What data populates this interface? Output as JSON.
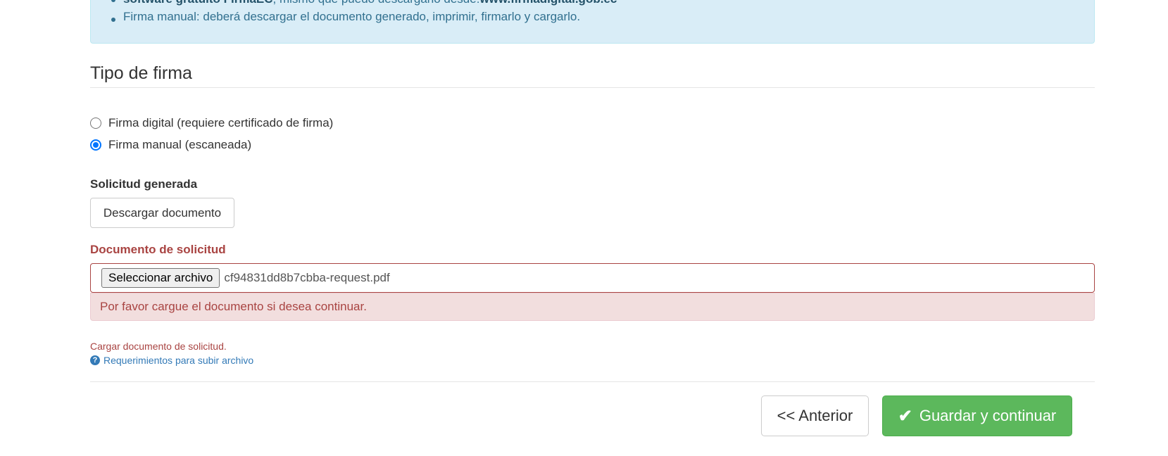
{
  "info": {
    "line1_prefix": "software gratuito ",
    "line1_bold1": "FirmaEC",
    "line1_mid": ", mismo que puedo descargarlo desde:",
    "line1_bold2": "www.firmadigital.gob.ec",
    "line2": "Firma manual: deberá descargar el documento generado, imprimir, firmarlo y cargarlo."
  },
  "section": {
    "title": "Tipo de firma"
  },
  "signature_options": [
    {
      "label": "Firma digital (requiere certificado de firma)",
      "checked": false
    },
    {
      "label": "Firma manual (escaneada)",
      "checked": true
    }
  ],
  "generated": {
    "label": "Solicitud generada",
    "download_button": "Descargar documento"
  },
  "document": {
    "label": "Documento de solicitud",
    "file_button": "Seleccionar archivo",
    "file_name": "cf94831dd8b7cbba-request.pdf",
    "error": "Por favor cargue el documento si desea continuar.",
    "help": "Cargar documento de solicitud.",
    "requirements_link": "Requerimientos para subir archivo",
    "requirements_icon": "question-circle-icon"
  },
  "footer": {
    "prev_button": "<< Anterior",
    "save_button": "Guardar y continuar",
    "save_icon": "check-icon"
  },
  "colors": {
    "info_bg": "#d9edf7",
    "error": "#a94442",
    "success": "#5cb85c",
    "link": "#337ab7",
    "radio_accent": "#0075ff"
  }
}
